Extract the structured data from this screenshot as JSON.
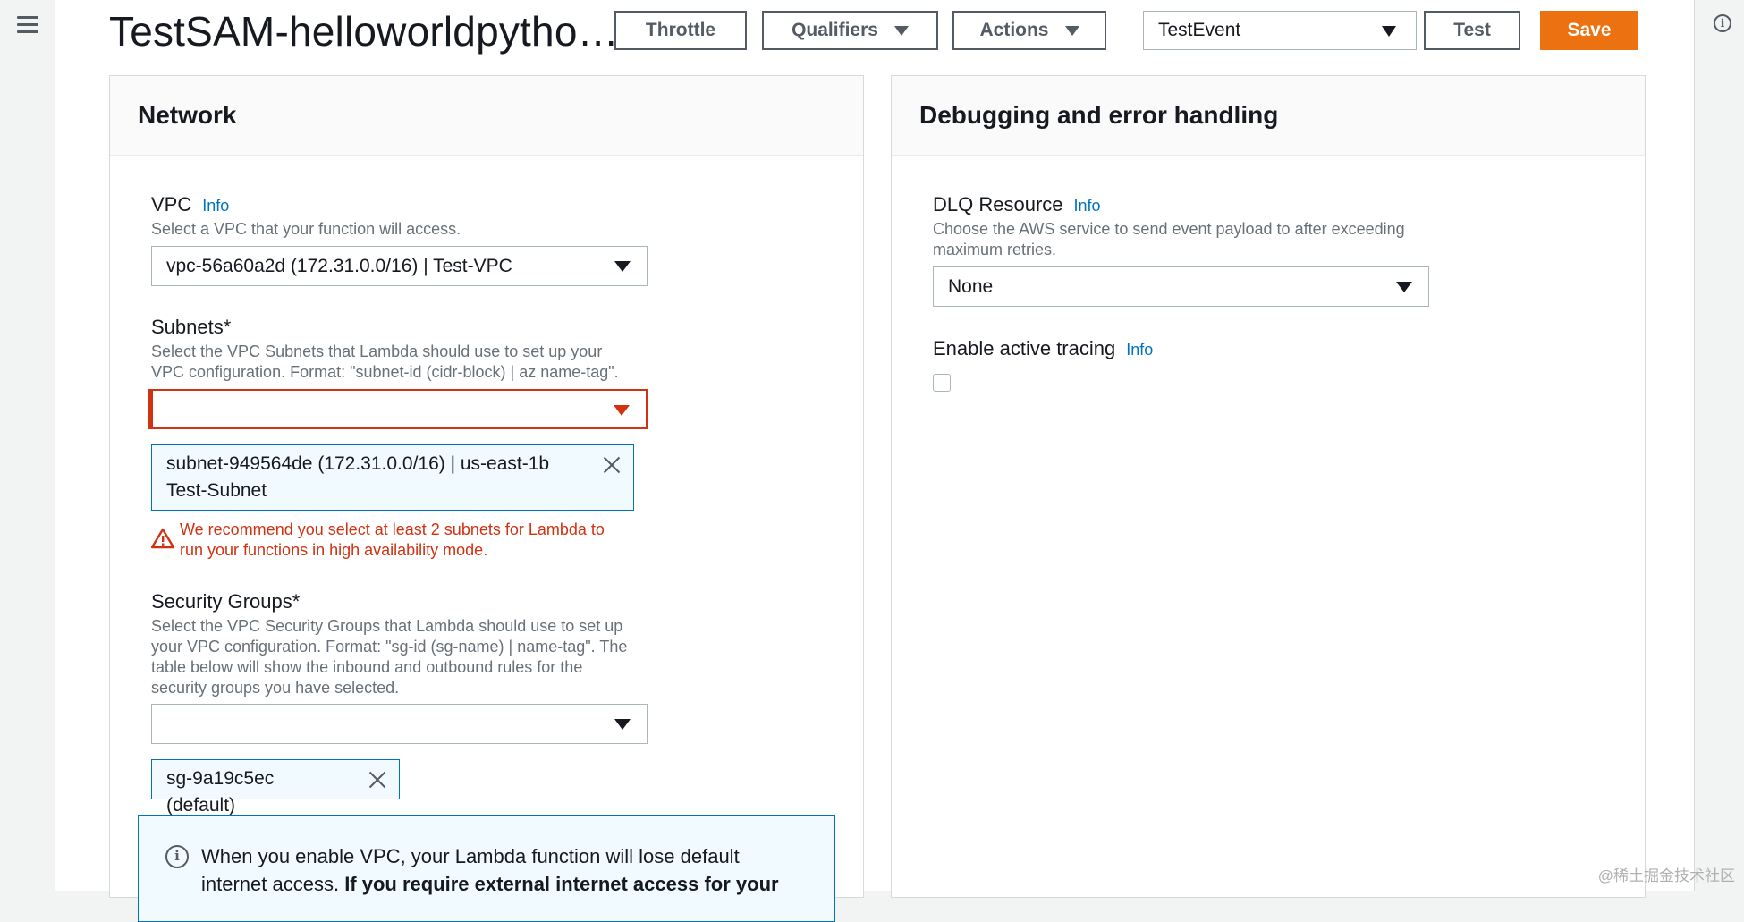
{
  "header": {
    "title": "TestSAM-helloworldpytho…",
    "throttle_label": "Throttle",
    "qualifiers_label": "Qualifiers",
    "actions_label": "Actions",
    "event_select_value": "TestEvent",
    "test_label": "Test",
    "save_label": "Save"
  },
  "network": {
    "heading": "Network",
    "vpc": {
      "label": "VPC",
      "info": "Info",
      "description": "Select a VPC that your function will access.",
      "value": "vpc-56a60a2d (172.31.0.0/16) | Test-VPC"
    },
    "subnets": {
      "label": "Subnets*",
      "description_line1": "Select the VPC Subnets that Lambda should use to set up your",
      "description_line2": "VPC configuration. Format: \"subnet-id (cidr-block) | az name-tag\".",
      "value": "",
      "token_line1": "subnet-949564de (172.31.0.0/16) | us-east-1b",
      "token_line2": "Test-Subnet",
      "warning_line1": "We recommend you select at least 2 subnets for Lambda to",
      "warning_line2": "run your functions in high availability mode."
    },
    "security_groups": {
      "label": "Security Groups*",
      "description_line1": "Select the VPC Security Groups that Lambda should use to set up",
      "description_line2": "your VPC configuration. Format: \"sg-id (sg-name) | name-tag\". The",
      "description_line3": "table below will show the inbound and outbound rules for the",
      "description_line4": "security groups you have selected.",
      "value": "",
      "token": "sg-9a19c5ec (default)"
    },
    "alert": {
      "text_line1": "When you enable VPC, your Lambda function will lose default",
      "text_line2_regular": "internet access. ",
      "text_line2_bold": "If you require external internet access for your"
    }
  },
  "debugging": {
    "heading": "Debugging and error handling",
    "dlq": {
      "label": "DLQ Resource",
      "info": "Info",
      "description_line1": "Choose the AWS service to send event payload to after exceeding",
      "description_line2": "maximum retries.",
      "value": "None"
    },
    "tracing": {
      "label": "Enable active tracing",
      "info": "Info"
    }
  },
  "watermark": "@稀土掘金技术社区",
  "colors": {
    "accent": "#ec7211",
    "link": "#0073bb",
    "error": "#d13212"
  }
}
